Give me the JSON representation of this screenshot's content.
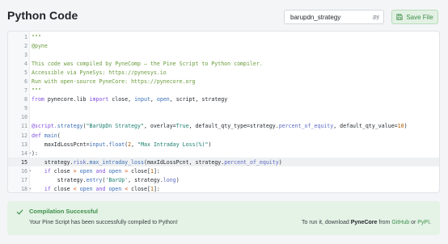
{
  "header": {
    "title": "Python Code",
    "filename_value": "barupdn_strategy",
    "filename_ext": ".py",
    "save_label": "Save File"
  },
  "editor": {
    "active_line": 15,
    "folded_lines": [
      14,
      16,
      18
    ],
    "lines": [
      {
        "n": "1",
        "tokens": [
          {
            "t": "\"\"\"",
            "c": "c-cmt"
          }
        ]
      },
      {
        "n": "2",
        "tokens": [
          {
            "t": "@pyne",
            "c": "c-cmt"
          }
        ]
      },
      {
        "n": "3",
        "tokens": []
      },
      {
        "n": "4",
        "tokens": [
          {
            "t": "This code was compiled by PyneComp — the Pine Script to Python compiler.",
            "c": "c-cmt"
          }
        ]
      },
      {
        "n": "5",
        "tokens": [
          {
            "t": "Accessible via PyneSys: https://pynesys.io",
            "c": "c-cmt"
          }
        ]
      },
      {
        "n": "6",
        "tokens": [
          {
            "t": "Run with open-source PyneCore: https://pynecore.org",
            "c": "c-cmt"
          }
        ]
      },
      {
        "n": "7",
        "tokens": [
          {
            "t": "\"\"\"",
            "c": "c-cmt"
          }
        ]
      },
      {
        "n": "8",
        "tokens": [
          {
            "t": "from ",
            "c": "c-key"
          },
          {
            "t": "pynecore.lib ",
            "c": ""
          },
          {
            "t": "import ",
            "c": "c-key"
          },
          {
            "t": "close, ",
            "c": ""
          },
          {
            "t": "input",
            "c": "c-fn"
          },
          {
            "t": ", ",
            "c": ""
          },
          {
            "t": "open",
            "c": "c-fn"
          },
          {
            "t": ", script, strategy",
            "c": ""
          }
        ]
      },
      {
        "n": "9",
        "tokens": []
      },
      {
        "n": "10",
        "tokens": []
      },
      {
        "n": "11",
        "tokens": [
          {
            "t": "@script.",
            "c": "c-key"
          },
          {
            "t": "strategy",
            "c": "c-fn"
          },
          {
            "t": "(",
            "c": ""
          },
          {
            "t": "\"BarUpDn Strategy\"",
            "c": "c-str"
          },
          {
            "t": ", overlay=",
            "c": ""
          },
          {
            "t": "True",
            "c": "c-bool"
          },
          {
            "t": ", default_qty_type=strategy.",
            "c": ""
          },
          {
            "t": "percent_of_equity",
            "c": "c-attr"
          },
          {
            "t": ", default_qty_value=",
            "c": ""
          },
          {
            "t": "10",
            "c": "c-num"
          },
          {
            "t": ")",
            "c": ""
          }
        ]
      },
      {
        "n": "12",
        "tokens": [
          {
            "t": "def ",
            "c": "c-key"
          },
          {
            "t": "main",
            "c": "c-fn"
          },
          {
            "t": "(",
            "c": ""
          }
        ]
      },
      {
        "n": "13",
        "tokens": [
          {
            "t": "    maxIdLossPcnt=",
            "c": ""
          },
          {
            "t": "input",
            "c": "c-fn"
          },
          {
            "t": ".",
            "c": ""
          },
          {
            "t": "float",
            "c": "c-fn"
          },
          {
            "t": "(",
            "c": ""
          },
          {
            "t": "2",
            "c": "c-num"
          },
          {
            "t": ", ",
            "c": ""
          },
          {
            "t": "\"Max Intraday Loss(%)\"",
            "c": "c-str"
          },
          {
            "t": ")",
            "c": ""
          }
        ]
      },
      {
        "n": "14",
        "tokens": [
          {
            "t": "):",
            "c": ""
          }
        ]
      },
      {
        "n": "15",
        "tokens": [
          {
            "t": "    strategy.",
            "c": ""
          },
          {
            "t": "risk",
            "c": "c-attr"
          },
          {
            "t": ".",
            "c": ""
          },
          {
            "t": "max_intraday_loss",
            "c": "c-fn"
          },
          {
            "t": "(maxIdLossPcnt, strategy.",
            "c": ""
          },
          {
            "t": "percent_of_equity",
            "c": "c-attr"
          },
          {
            "t": ")",
            "c": ""
          }
        ]
      },
      {
        "n": "16",
        "tokens": [
          {
            "t": "    if ",
            "c": "c-key"
          },
          {
            "t": "close ",
            "c": ""
          },
          {
            "t": "> ",
            "c": "c-op"
          },
          {
            "t": "open ",
            "c": "c-fn"
          },
          {
            "t": "and ",
            "c": "c-key"
          },
          {
            "t": "open ",
            "c": "c-fn"
          },
          {
            "t": "> ",
            "c": "c-op"
          },
          {
            "t": "close[",
            "c": ""
          },
          {
            "t": "1",
            "c": "c-num"
          },
          {
            "t": "]:",
            "c": ""
          }
        ]
      },
      {
        "n": "17",
        "tokens": [
          {
            "t": "        strategy.",
            "c": ""
          },
          {
            "t": "entry",
            "c": "c-fn"
          },
          {
            "t": "(",
            "c": ""
          },
          {
            "t": "'BarUp'",
            "c": "c-str"
          },
          {
            "t": ", strategy.",
            "c": ""
          },
          {
            "t": "long",
            "c": "c-attr"
          },
          {
            "t": ")",
            "c": ""
          }
        ]
      },
      {
        "n": "18",
        "tokens": [
          {
            "t": "    if ",
            "c": "c-key"
          },
          {
            "t": "close ",
            "c": ""
          },
          {
            "t": "< ",
            "c": "c-op"
          },
          {
            "t": "open ",
            "c": "c-fn"
          },
          {
            "t": "and ",
            "c": "c-key"
          },
          {
            "t": "open ",
            "c": "c-fn"
          },
          {
            "t": "< ",
            "c": "c-op"
          },
          {
            "t": "close[",
            "c": ""
          },
          {
            "t": "1",
            "c": "c-num"
          },
          {
            "t": "]:",
            "c": ""
          }
        ]
      }
    ]
  },
  "status": {
    "title": "Compilation Successful",
    "message": "Your Pine Script has been successfully compiled to Python!",
    "run_prefix": "To run it, download ",
    "run_product": "PyneCore",
    "run_from": " from ",
    "run_link1": "GitHub",
    "run_or": " or ",
    "run_link2": "PyPI",
    "run_suffix": "."
  }
}
